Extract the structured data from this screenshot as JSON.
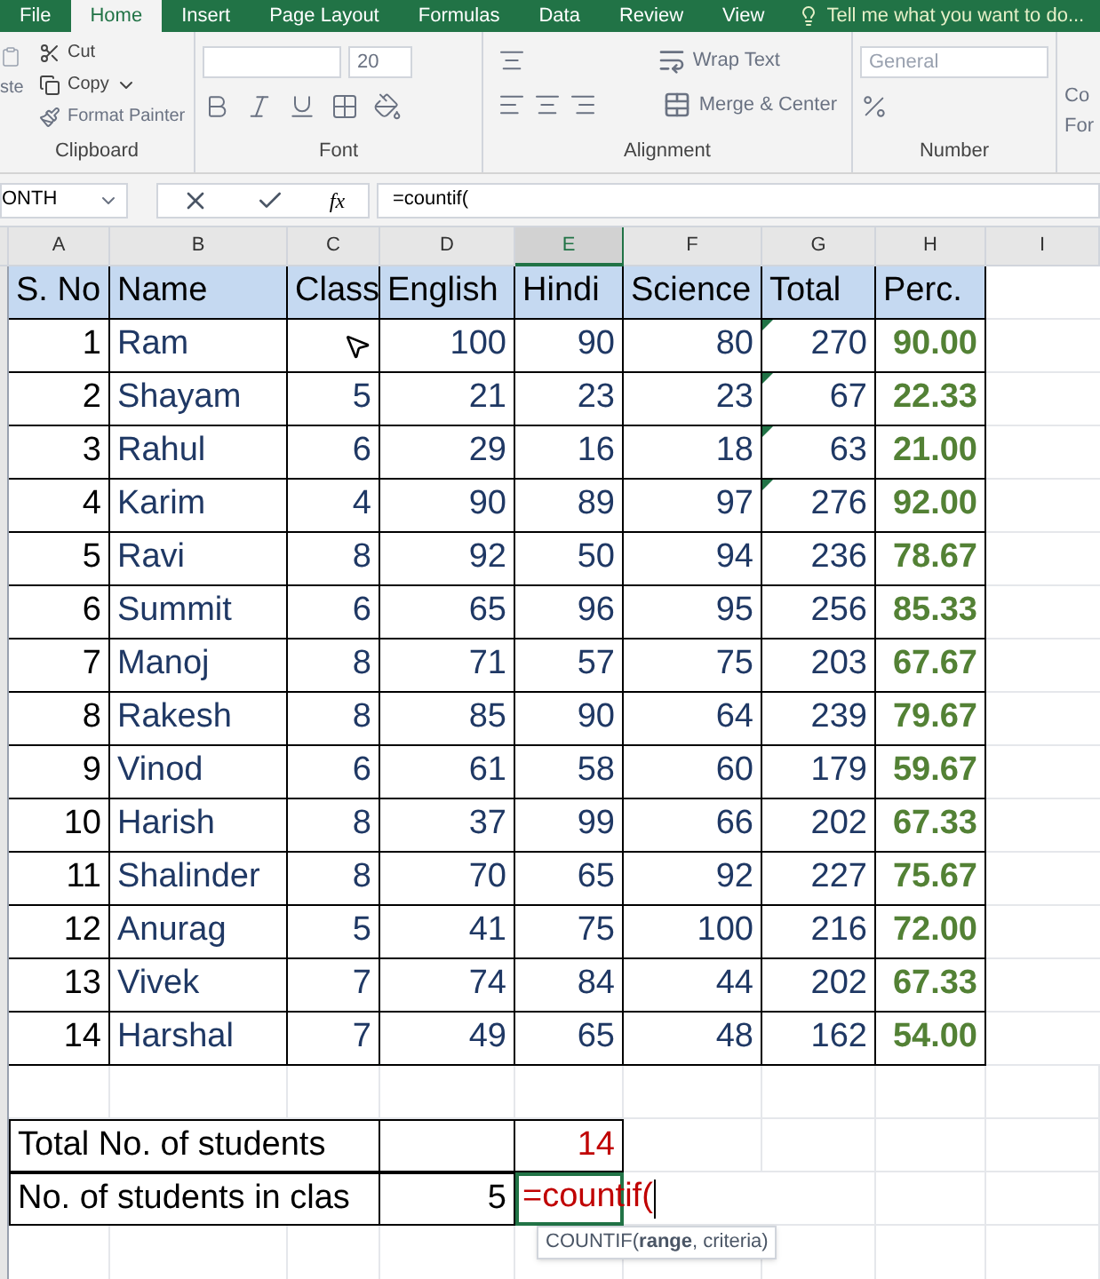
{
  "ribbon_tabs": [
    {
      "label": "File",
      "selected": false
    },
    {
      "label": "Home",
      "selected": true
    },
    {
      "label": "Insert",
      "selected": false
    },
    {
      "label": "Page Layout",
      "selected": false
    },
    {
      "label": "Formulas",
      "selected": false
    },
    {
      "label": "Data",
      "selected": false
    },
    {
      "label": "Review",
      "selected": false
    },
    {
      "label": "View",
      "selected": false
    }
  ],
  "tell_me": "Tell me what you want to do...",
  "clipboard": {
    "paste": "ste",
    "cut": "Cut",
    "copy": "Copy",
    "format_painter": "Format Painter",
    "group": "Clipboard"
  },
  "font": {
    "size": "20",
    "group": "Font"
  },
  "alignment": {
    "wrap": "Wrap Text",
    "merge": "Merge & Center",
    "group": "Alignment"
  },
  "number": {
    "format": "General",
    "group": "Number"
  },
  "styles": {
    "line_1": "Co",
    "line_2": "For"
  },
  "name_box": "ONTH",
  "function_label": "fx",
  "formula": "=countif(",
  "columns": [
    {
      "label": "A",
      "selected": false
    },
    {
      "label": "B",
      "selected": false
    },
    {
      "label": "C",
      "selected": false
    },
    {
      "label": "D",
      "selected": false
    },
    {
      "label": "E",
      "selected": true
    },
    {
      "label": "F",
      "selected": false
    },
    {
      "label": "G",
      "selected": false
    },
    {
      "label": "H",
      "selected": false
    },
    {
      "label": "I",
      "selected": false
    }
  ],
  "headers": [
    "S. No",
    "Name",
    "Class",
    "English",
    "Hindi",
    "Science",
    "Total",
    "Perc."
  ],
  "rows": [
    {
      "no": "1",
      "name": "Ram",
      "english": "100",
      "hindi": "90",
      "science": "80",
      "total": "270",
      "perc": "90.00",
      "flag": true
    },
    {
      "no": "2",
      "name": "Shayam",
      "class": "5",
      "english": "21",
      "hindi": "23",
      "science": "23",
      "total": "67",
      "perc": "22.33",
      "flag": true
    },
    {
      "no": "3",
      "name": "Rahul",
      "class": "6",
      "english": "29",
      "hindi": "16",
      "science": "18",
      "total": "63",
      "perc": "21.00",
      "flag": true
    },
    {
      "no": "4",
      "name": "Karim",
      "class": "4",
      "english": "90",
      "hindi": "89",
      "science": "97",
      "total": "276",
      "perc": "92.00",
      "flag": true
    },
    {
      "no": "5",
      "name": "Ravi",
      "class": "8",
      "english": "92",
      "hindi": "50",
      "science": "94",
      "total": "236",
      "perc": "78.67",
      "flag": false
    },
    {
      "no": "6",
      "name": "Summit",
      "class": "6",
      "english": "65",
      "hindi": "96",
      "science": "95",
      "total": "256",
      "perc": "85.33",
      "flag": false
    },
    {
      "no": "7",
      "name": "Manoj",
      "class": "8",
      "english": "71",
      "hindi": "57",
      "science": "75",
      "total": "203",
      "perc": "67.67",
      "flag": false
    },
    {
      "no": "8",
      "name": "Rakesh",
      "class": "8",
      "english": "85",
      "hindi": "90",
      "science": "64",
      "total": "239",
      "perc": "79.67",
      "flag": false
    },
    {
      "no": "9",
      "name": "Vinod",
      "class": "6",
      "english": "61",
      "hindi": "58",
      "science": "60",
      "total": "179",
      "perc": "59.67",
      "flag": false
    },
    {
      "no": "10",
      "name": "Harish",
      "class": "8",
      "english": "37",
      "hindi": "99",
      "science": "66",
      "total": "202",
      "perc": "67.33",
      "flag": false
    },
    {
      "no": "11",
      "name": "Shalinder",
      "class": "8",
      "english": "70",
      "hindi": "65",
      "science": "92",
      "total": "227",
      "perc": "75.67",
      "flag": false
    },
    {
      "no": "12",
      "name": "Anurag",
      "class": "5",
      "english": "41",
      "hindi": "75",
      "science": "100",
      "total": "216",
      "perc": "72.00",
      "flag": false
    },
    {
      "no": "13",
      "name": "Vivek",
      "class": "7",
      "english": "74",
      "hindi": "84",
      "science": "44",
      "total": "202",
      "perc": "67.33",
      "flag": false
    },
    {
      "no": "14",
      "name": "Harshal",
      "class": "7",
      "english": "49",
      "hindi": "65",
      "science": "48",
      "total": "162",
      "perc": "54.00",
      "flag": false
    }
  ],
  "summary": [
    {
      "label": "Total No. of students",
      "value": "14",
      "editing": false
    },
    {
      "label": "No. of students in clas",
      "criteria": "5",
      "value": "=countif(",
      "editing": true
    }
  ],
  "tooltip": "COUNTIF(**range**, criteria)"
}
